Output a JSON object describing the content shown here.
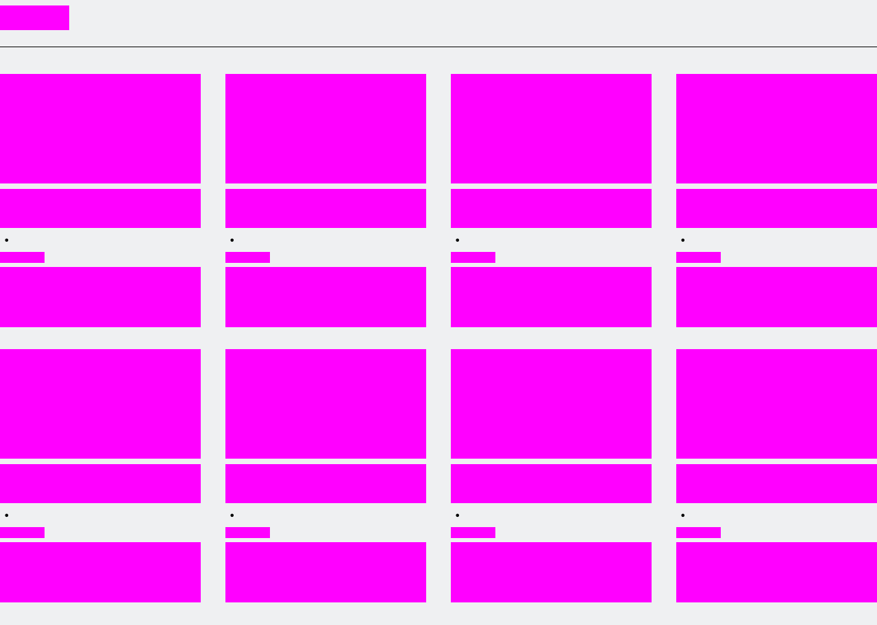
{
  "colors": {
    "background": "#eff0f2",
    "placeholder": "#ff00ff",
    "divider": "#000000"
  },
  "header": {
    "logo_icon": "logo-placeholder"
  },
  "cards": [
    {
      "bullet": "•"
    },
    {
      "bullet": "•"
    },
    {
      "bullet": "•"
    },
    {
      "bullet": "•"
    },
    {
      "bullet": "•"
    },
    {
      "bullet": "•"
    },
    {
      "bullet": "•"
    },
    {
      "bullet": "•"
    }
  ]
}
